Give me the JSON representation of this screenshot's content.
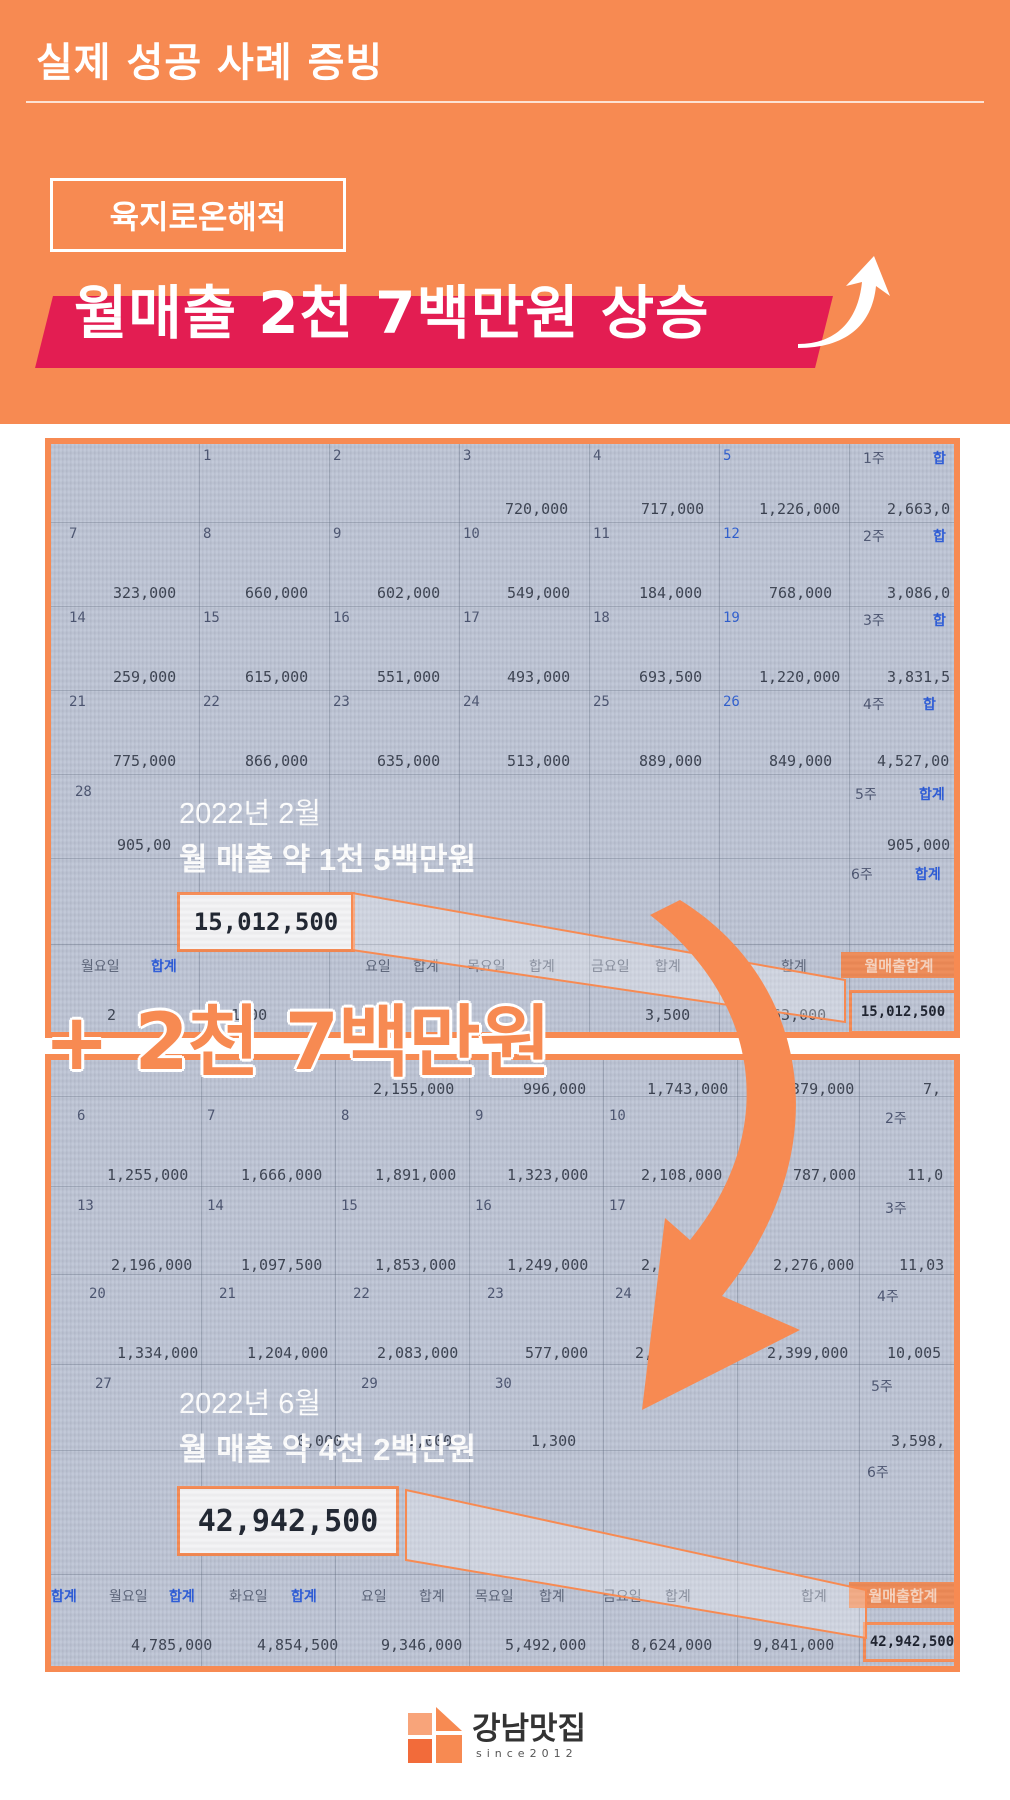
{
  "header": {
    "title": "실제 성공 사례 증빙",
    "store_name": "육지로온해적",
    "headline": "월매출 2천 7백만원 상승"
  },
  "before": {
    "date": "2022년 2월",
    "description": "월 매출 약 1천 5백만원",
    "total": "15,012,500",
    "total_small": "15,012,500",
    "footer_highlight": "월매출합계",
    "grid": {
      "col_headers": [
        "1",
        "2",
        "3",
        "4",
        "5",
        "1주",
        "합"
      ],
      "rows": [
        {
          "days": [
            "7",
            "8",
            "9",
            "10",
            "11",
            "12",
            "2주",
            "합"
          ],
          "values": [
            "323,000",
            "660,000",
            "602,000",
            "549,000",
            "184,000",
            "768,000",
            "3,086,0"
          ]
        },
        {
          "days": [
            "14",
            "15",
            "16",
            "17",
            "18",
            "19",
            "3주",
            "합"
          ],
          "values": [
            "259,000",
            "615,000",
            "551,000",
            "493,000",
            "693,500",
            "1,220,000",
            "3,831,5"
          ]
        },
        {
          "days": [
            "21",
            "22",
            "23",
            "24",
            "25",
            "26",
            "4주",
            "합"
          ],
          "values": [
            "775,000",
            "866,000",
            "635,000",
            "513,000",
            "889,000",
            "849,000",
            "4,527,00"
          ]
        }
      ],
      "row0_values": [
        "720,000",
        "717,000",
        "1,226,000",
        "2,663,0"
      ],
      "last_day": "28",
      "last_value": "905,00",
      "week5": "5주",
      "week5_label": "합계",
      "week5_value": "905,000",
      "week6": "6주",
      "week6_label": "합계",
      "weekday_footer": [
        "월요일",
        "합계",
        "요일",
        "합계",
        "목요일",
        "합계",
        "금요일",
        "합계",
        "합계"
      ],
      "footer_values": [
        "2",
        "1,00",
        "3,500",
        "063,000"
      ]
    }
  },
  "increase_text": "+ 2천 7백만원",
  "after": {
    "date": "2022년 6월",
    "description": "월 매출 약 4천 2백만원",
    "total": "42,942,500",
    "total_small": "42,942,500",
    "footer_highlight": "월매출합계",
    "grid": {
      "row0_values": [
        "2,155,000",
        "996,000",
        "1,743,000",
        "2,379,000",
        "7,"
      ],
      "rows": [
        {
          "days": [
            "6",
            "7",
            "8",
            "9",
            "10",
            "",
            "2주"
          ],
          "values": [
            "1,255,000",
            "1,666,000",
            "1,891,000",
            "1,323,000",
            "2,108,000",
            "787,000",
            "11,0"
          ]
        },
        {
          "days": [
            "13",
            "14",
            "15",
            "16",
            "17",
            "",
            "3주"
          ],
          "values": [
            "2,196,000",
            "1,097,500",
            "1,853,000",
            "1,249,000",
            "2,",
            "2,276,000",
            "11,03"
          ]
        },
        {
          "days": [
            "20",
            "21",
            "22",
            "23",
            "24",
            "",
            "4주"
          ],
          "values": [
            "1,334,000",
            "1,204,000",
            "2,083,000",
            "577,000",
            "2,",
            "2,399,000",
            "10,005"
          ]
        }
      ],
      "last_days": [
        "27",
        "29",
        "30"
      ],
      "week5": "5주",
      "week5_value": "3,598,",
      "week6": "6주",
      "partial_values": [
        "0,000",
        "1,000",
        "1,300"
      ],
      "weekday_footer": [
        "합계",
        "월요일",
        "합계",
        "화요일",
        "합계",
        "요일",
        "합계",
        "목요일",
        "합계",
        "금요일",
        "합계",
        "합계"
      ],
      "footer_values": [
        "4,785,000",
        "4,854,500",
        "9,346,000",
        "5,492,000",
        "8,624,000",
        "9,841,000"
      ]
    }
  },
  "logo": {
    "name": "강남맛집",
    "since": "since2012"
  },
  "colors": {
    "brand_orange": "#f78a52",
    "headline_red": "#e31d52",
    "white": "#ffffff"
  }
}
